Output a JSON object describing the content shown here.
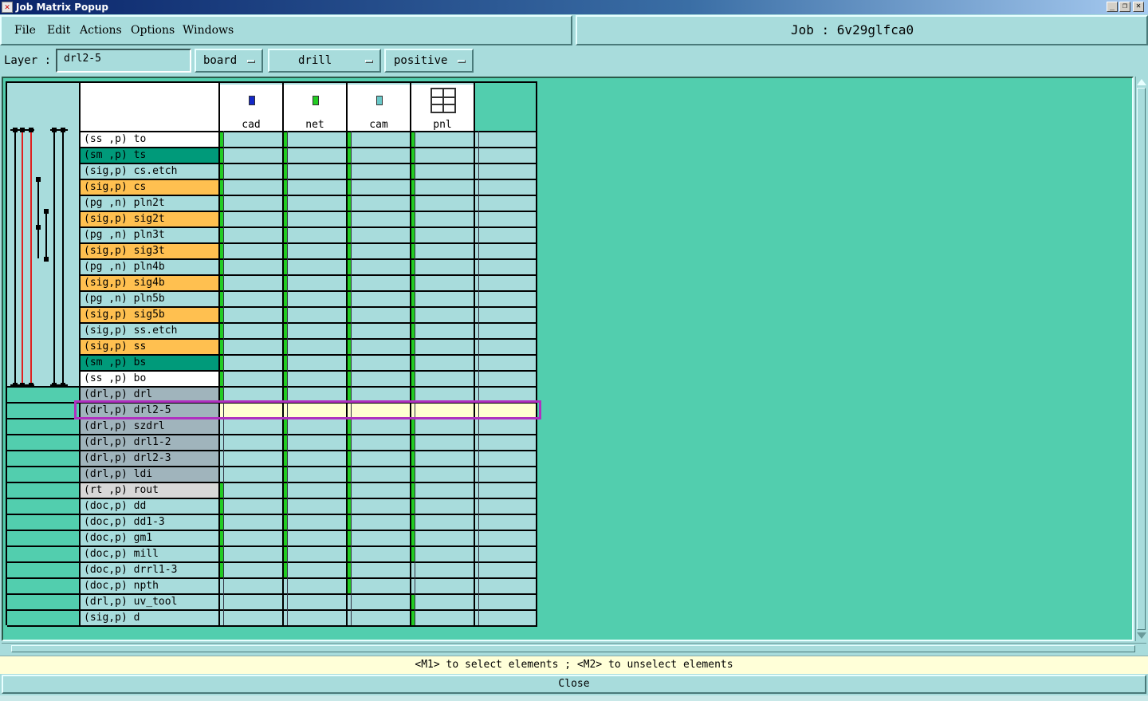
{
  "window": {
    "title": "Job Matrix Popup"
  },
  "menu": [
    "File",
    "Edit",
    "Actions",
    "Options",
    "Windows"
  ],
  "job": {
    "label": "Job : 6v29glfca0"
  },
  "layer": {
    "label": "Layer :",
    "value": "drl2-5",
    "context": "board",
    "type": "drill",
    "polarity": "positive"
  },
  "columns": [
    "cad",
    "net",
    "cam",
    "pnl"
  ],
  "rows": [
    {
      "label": "(ss ,p) to",
      "color": "#ffffff",
      "marks": [
        1,
        1,
        1,
        1
      ]
    },
    {
      "label": "(sm ,p) ts",
      "color": "#009a7a",
      "marks": [
        1,
        1,
        1,
        1
      ]
    },
    {
      "label": "(sig,p) cs.etch",
      "color": "#a8dcdc",
      "marks": [
        1,
        1,
        1,
        1
      ]
    },
    {
      "label": "(sig,p) cs",
      "color": "#ffc050",
      "marks": [
        1,
        1,
        1,
        1
      ]
    },
    {
      "label": "(pg ,n) pln2t",
      "color": "#a8dcdc",
      "marks": [
        1,
        1,
        1,
        1
      ]
    },
    {
      "label": "(sig,p) sig2t",
      "color": "#ffc050",
      "marks": [
        1,
        1,
        1,
        1
      ]
    },
    {
      "label": "(pg ,n) pln3t",
      "color": "#a8dcdc",
      "marks": [
        1,
        1,
        1,
        1
      ]
    },
    {
      "label": "(sig,p) sig3t",
      "color": "#ffc050",
      "marks": [
        1,
        1,
        1,
        1
      ]
    },
    {
      "label": "(pg ,n) pln4b",
      "color": "#a8dcdc",
      "marks": [
        1,
        1,
        1,
        1
      ]
    },
    {
      "label": "(sig,p) sig4b",
      "color": "#ffc050",
      "marks": [
        1,
        1,
        1,
        1
      ]
    },
    {
      "label": "(pg ,n) pln5b",
      "color": "#a8dcdc",
      "marks": [
        1,
        1,
        1,
        1
      ]
    },
    {
      "label": "(sig,p) sig5b",
      "color": "#ffc050",
      "marks": [
        1,
        1,
        1,
        1
      ]
    },
    {
      "label": "(sig,p) ss.etch",
      "color": "#a8dcdc",
      "marks": [
        1,
        1,
        1,
        1
      ]
    },
    {
      "label": "(sig,p) ss",
      "color": "#ffc050",
      "marks": [
        1,
        1,
        1,
        1
      ]
    },
    {
      "label": "(sm ,p) bs",
      "color": "#009a7a",
      "marks": [
        1,
        1,
        1,
        1
      ]
    },
    {
      "label": "(ss ,p) bo",
      "color": "#ffffff",
      "marks": [
        1,
        1,
        1,
        1
      ]
    },
    {
      "label": "(drl,p) drl",
      "color": "#a0b4bc",
      "marks": [
        1,
        1,
        1,
        1
      ]
    },
    {
      "label": "(drl,p) drl2-5",
      "color": "#a0b4bc",
      "marks": [
        1,
        1,
        1,
        1
      ],
      "selected": true
    },
    {
      "label": "(drl,p) szdrl",
      "color": "#a0b4bc",
      "marks": [
        0,
        1,
        1,
        1
      ]
    },
    {
      "label": "(drl,p) drl1-2",
      "color": "#a0b4bc",
      "marks": [
        0,
        1,
        1,
        1
      ]
    },
    {
      "label": "(drl,p) drl2-3",
      "color": "#a0b4bc",
      "marks": [
        0,
        1,
        1,
        1
      ]
    },
    {
      "label": "(drl,p) ldi",
      "color": "#a0b4bc",
      "marks": [
        0,
        1,
        1,
        1
      ]
    },
    {
      "label": "(rt ,p) rout",
      "color": "#d8d8d8",
      "marks": [
        1,
        1,
        1,
        1
      ]
    },
    {
      "label": "(doc,p) dd",
      "color": "#a8dcdc",
      "marks": [
        1,
        1,
        1,
        1
      ]
    },
    {
      "label": "(doc,p) dd1-3",
      "color": "#a8dcdc",
      "marks": [
        1,
        1,
        1,
        1
      ]
    },
    {
      "label": "(doc,p) gm1",
      "color": "#a8dcdc",
      "marks": [
        1,
        1,
        1,
        1
      ]
    },
    {
      "label": "(doc,p) mill",
      "color": "#a8dcdc",
      "marks": [
        1,
        1,
        1,
        1
      ]
    },
    {
      "label": "(doc,p) drrl1-3",
      "color": "#a8dcdc",
      "marks": [
        1,
        1,
        1,
        0
      ]
    },
    {
      "label": "(doc,p) npth",
      "color": "#a8dcdc",
      "marks": [
        0,
        0,
        1,
        0
      ]
    },
    {
      "label": "(drl,p) uv_tool",
      "color": "#a8dcdc",
      "marks": [
        0,
        0,
        0,
        1
      ]
    },
    {
      "label": "(sig,p) d",
      "color": "#a8dcdc",
      "marks": [
        0,
        0,
        0,
        1
      ]
    }
  ],
  "status": "<M1> to select elements ; <M2> to unselect elements",
  "close_label": "Close"
}
